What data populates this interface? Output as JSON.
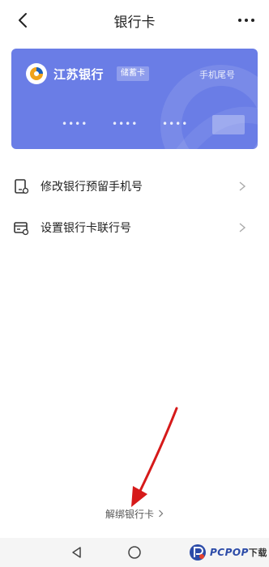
{
  "header": {
    "title": "银行卡"
  },
  "card": {
    "bank_name": "江苏银行",
    "type": "储蓄卡",
    "phone_tail_label": "手机尾号",
    "groups": [
      "••••",
      "••••",
      "••••"
    ],
    "color": "#6a7de6"
  },
  "menu": {
    "items": [
      {
        "label": "修改银行预留手机号",
        "icon": "phone-edit-icon"
      },
      {
        "label": "设置银行卡联行号",
        "icon": "card-settings-icon"
      }
    ]
  },
  "footer": {
    "unbind_label": "解绑银行卡"
  },
  "watermark": {
    "text": "PCPOP",
    "suffix": "下载"
  }
}
